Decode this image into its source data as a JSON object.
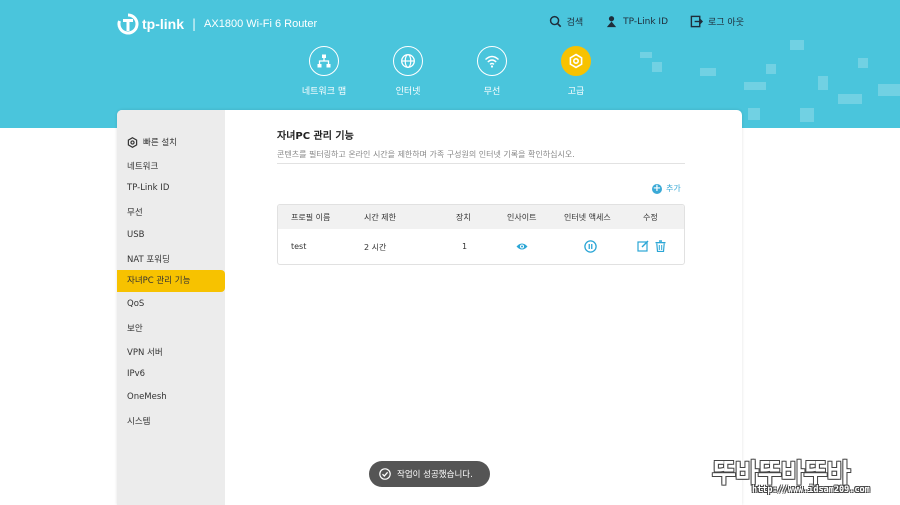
{
  "brand": {
    "logo": "tp-link",
    "separator": "|",
    "model": "AX1800 Wi-Fi 6 Router"
  },
  "top_links": {
    "search": "검색",
    "tplink_id": "TP-Link ID",
    "logout": "로그 아웃"
  },
  "nav": [
    {
      "label": "네트워크 맵",
      "icon": "network-map-icon"
    },
    {
      "label": "인터넷",
      "icon": "globe-icon"
    },
    {
      "label": "무선",
      "icon": "wifi-icon"
    },
    {
      "label": "고급",
      "icon": "gear-icon",
      "active": true
    }
  ],
  "sidebar": {
    "quick_setup": "빠른 설치",
    "items": [
      "네트워크",
      "TP-Link ID",
      "무선",
      "USB",
      "NAT 포워딩",
      "자녀PC 관리 기능",
      "QoS",
      "보안",
      "VPN 서버",
      "IPv6",
      "OneMesh",
      "시스템"
    ],
    "active_index": 5
  },
  "content": {
    "title": "자녀PC 관리 기능",
    "description": "콘텐츠를 필터링하고 온라인 시간을 제한하며 가족 구성원의 인터넷 기록을 확인하십시오.",
    "add_label": "추가"
  },
  "table": {
    "headers": [
      "프로필 이름",
      "시간 제한",
      "장치",
      "인사이트",
      "인터넷 액세스",
      "수정"
    ],
    "rows": [
      {
        "profile": "test",
        "time_limit": "2 시간",
        "devices": "1"
      }
    ]
  },
  "toast": "작업이 성공했습니다.",
  "watermark": {
    "text": "뚜바뚜바뚜바",
    "url": "http://www.idsam209.com"
  },
  "colors": {
    "header": "#4ac5dc",
    "accent": "#f7c200",
    "link": "#3aa9d6"
  }
}
